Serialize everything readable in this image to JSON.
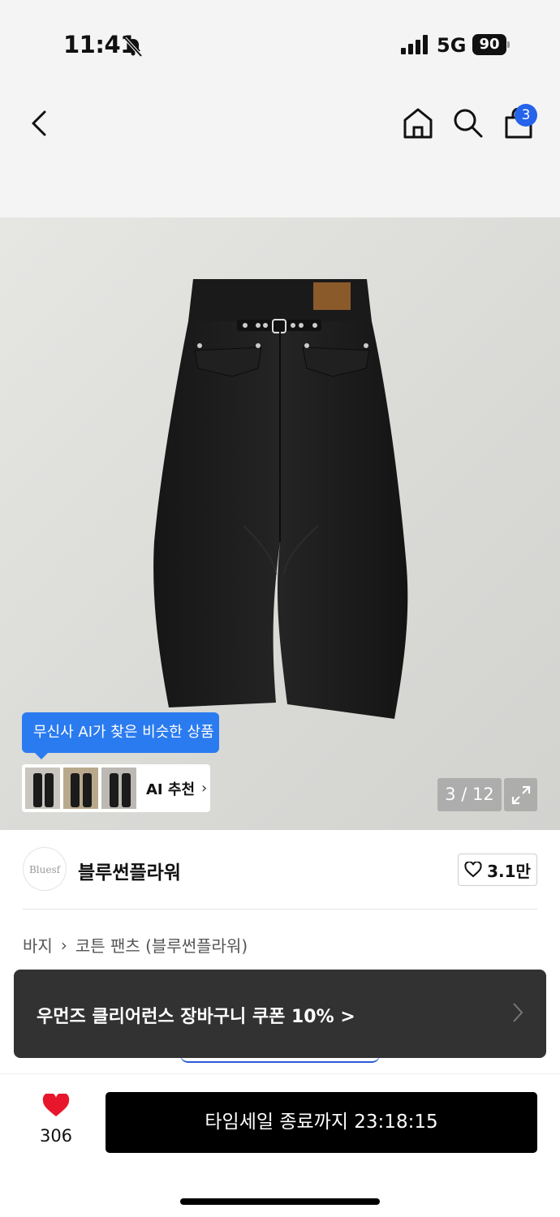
{
  "status_bar": {
    "time": "11:41",
    "network": "5G",
    "battery": "90"
  },
  "nav": {
    "cart_count": "3"
  },
  "gallery": {
    "ai_tooltip": "무신사 AI가 찾은 비슷한 상품",
    "ai_label": "AI 추천",
    "page_counter": "3 / 12"
  },
  "brand": {
    "logo_text": "Bluesf",
    "name": "블루썬플라워",
    "like_count": "3.1만"
  },
  "breadcrumb": {
    "category": "바지",
    "subcategory": "코튼 팬츠 (블루썬플라워)"
  },
  "coupon": {
    "text": "우먼즈 클리어런스 장바구니 쿠폰 10% >"
  },
  "action_bar": {
    "heart_count": "306",
    "buy_label": "타임세일 종료까지 23:18:15"
  },
  "colors": {
    "accent_blue": "#2b7bf0",
    "heart_red": "#e8162b"
  }
}
